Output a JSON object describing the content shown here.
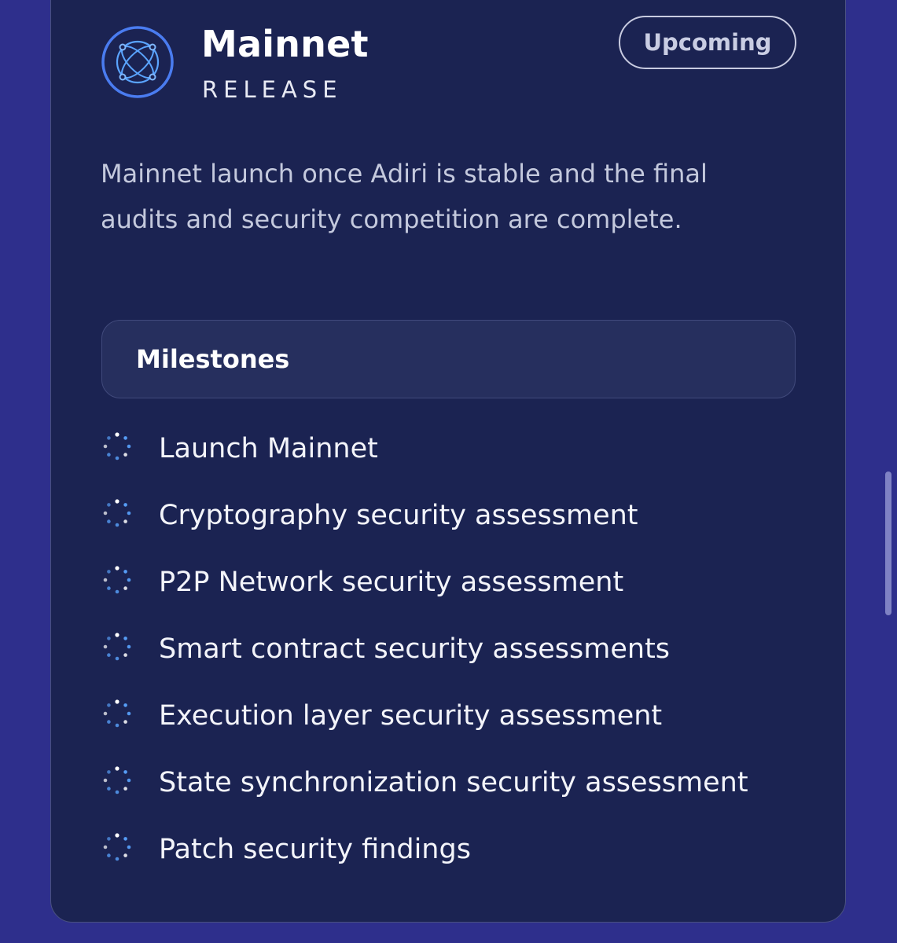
{
  "release": {
    "title": "Mainnet",
    "subtitle": "RELEASE",
    "status": "Upcoming",
    "description": "Mainnet launch once Adiri is stable and the final audits and security competition are complete."
  },
  "milestones": {
    "heading": "Milestones",
    "items": [
      {
        "label": "Launch Mainnet",
        "icon": "spinner-icon"
      },
      {
        "label": "Cryptography security assessment",
        "icon": "spinner-icon"
      },
      {
        "label": "P2P Network security assessment",
        "icon": "spinner-icon"
      },
      {
        "label": "Smart contract security assessments",
        "icon": "spinner-icon"
      },
      {
        "label": "Execution layer security assessment",
        "icon": "spinner-icon"
      },
      {
        "label": "State synchronization security assessment",
        "icon": "spinner-icon"
      },
      {
        "label": "Patch security findings",
        "icon": "spinner-icon"
      }
    ]
  },
  "colors": {
    "page_background": "#2e2f8c",
    "card_background": "#1b2352",
    "accent_blue": "#4a7cf0",
    "spinner_blue": "#5aa4ff"
  },
  "icons": {
    "logo": "globe-network-logo-icon",
    "milestone_status": "spinner-icon"
  }
}
